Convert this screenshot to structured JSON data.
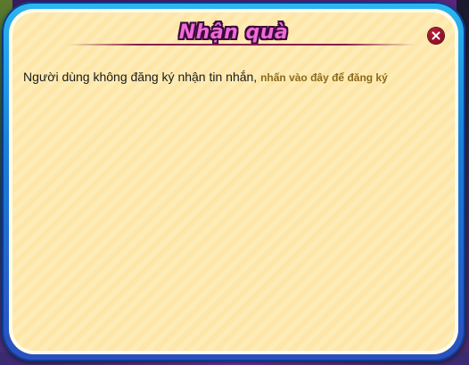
{
  "dialog": {
    "title": "Nhận quà",
    "message": "Người dùng không đăng ký nhận tin nhắn,",
    "link_label": "nhấn vào đây để đăng ký",
    "close_icon": "close-icon"
  },
  "colors": {
    "frame_blue": "#1a7fd8",
    "panel_cream": "#feecb6",
    "title_pink": "#f06ad8",
    "title_outline": "#3a0a3a",
    "link_gold": "#8a6a1a",
    "close_red": "#a0182e"
  }
}
